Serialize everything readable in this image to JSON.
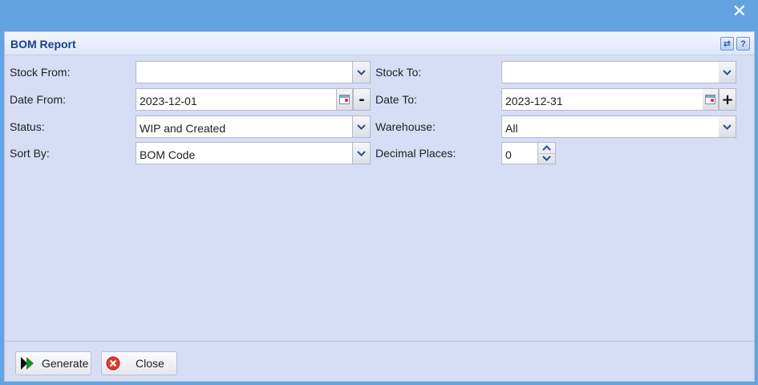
{
  "window": {
    "close_glyph": "✕"
  },
  "panel": {
    "title": "BOM Report",
    "tools": [
      {
        "icon": "refresh-icon",
        "glyph": "⇄"
      },
      {
        "icon": "help-icon",
        "glyph": "?"
      }
    ]
  },
  "form": {
    "stock_from": {
      "label": "Stock From:",
      "value": ""
    },
    "stock_to": {
      "label": "Stock To:",
      "value": ""
    },
    "date_from": {
      "label": "Date From:",
      "value": "2023-12-01",
      "button": "-"
    },
    "date_to": {
      "label": "Date To:",
      "value": "2023-12-31",
      "button": "+"
    },
    "status": {
      "label": "Status:",
      "value": "WIP and Created"
    },
    "warehouse": {
      "label": "Warehouse:",
      "value": "All"
    },
    "sort_by": {
      "label": "Sort By:",
      "value": "BOM Code"
    },
    "decimal_places": {
      "label": "Decimal Places:",
      "value": "0"
    }
  },
  "footer": {
    "generate_label": "Generate",
    "close_label": "Close"
  },
  "colors": {
    "window_bg": "#63a3e0",
    "panel_bg": "#d6ddf5",
    "title_color": "#15428b",
    "generate_icon": "#1a8f2a",
    "close_icon": "#e03a2f"
  }
}
